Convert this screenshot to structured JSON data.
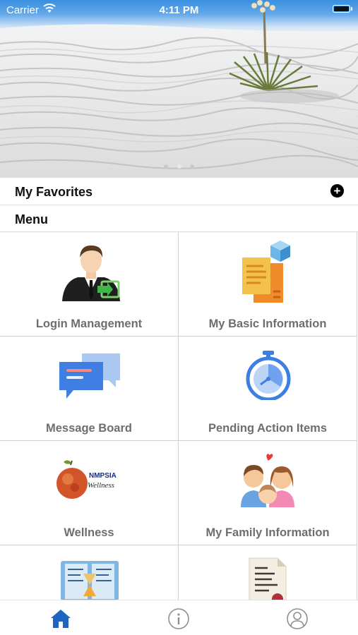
{
  "status_bar": {
    "carrier": "Carrier",
    "time": "4:11 PM"
  },
  "favorites": {
    "label": "My Favorites",
    "add_icon": "plus-circle-icon"
  },
  "menu": {
    "label": "Menu",
    "items": [
      {
        "label": "Login Management",
        "icon": "user-login-icon"
      },
      {
        "label": "My Basic Information",
        "icon": "documents-icon"
      },
      {
        "label": "Message Board",
        "icon": "chat-bubbles-icon"
      },
      {
        "label": "Pending Action Items",
        "icon": "stopwatch-icon"
      },
      {
        "label": "Wellness",
        "icon": "nmpsia-wellness-logo"
      },
      {
        "label": "My Family Information",
        "icon": "family-icon"
      },
      {
        "label": "",
        "icon": "hourglass-book-icon"
      },
      {
        "label": "",
        "icon": "certificate-document-icon"
      }
    ]
  },
  "wellness_logo": {
    "line1": "NMPSIA",
    "line2": "Wellness"
  },
  "tab_bar": {
    "tabs": [
      {
        "name": "home",
        "icon": "home-icon",
        "active": true
      },
      {
        "name": "info",
        "icon": "info-icon",
        "active": false
      },
      {
        "name": "profile",
        "icon": "user-icon",
        "active": false
      }
    ]
  },
  "colors": {
    "accent": "#1c66c2",
    "label": "#6e6e6e",
    "inactive_tab": "#8e8e93"
  }
}
